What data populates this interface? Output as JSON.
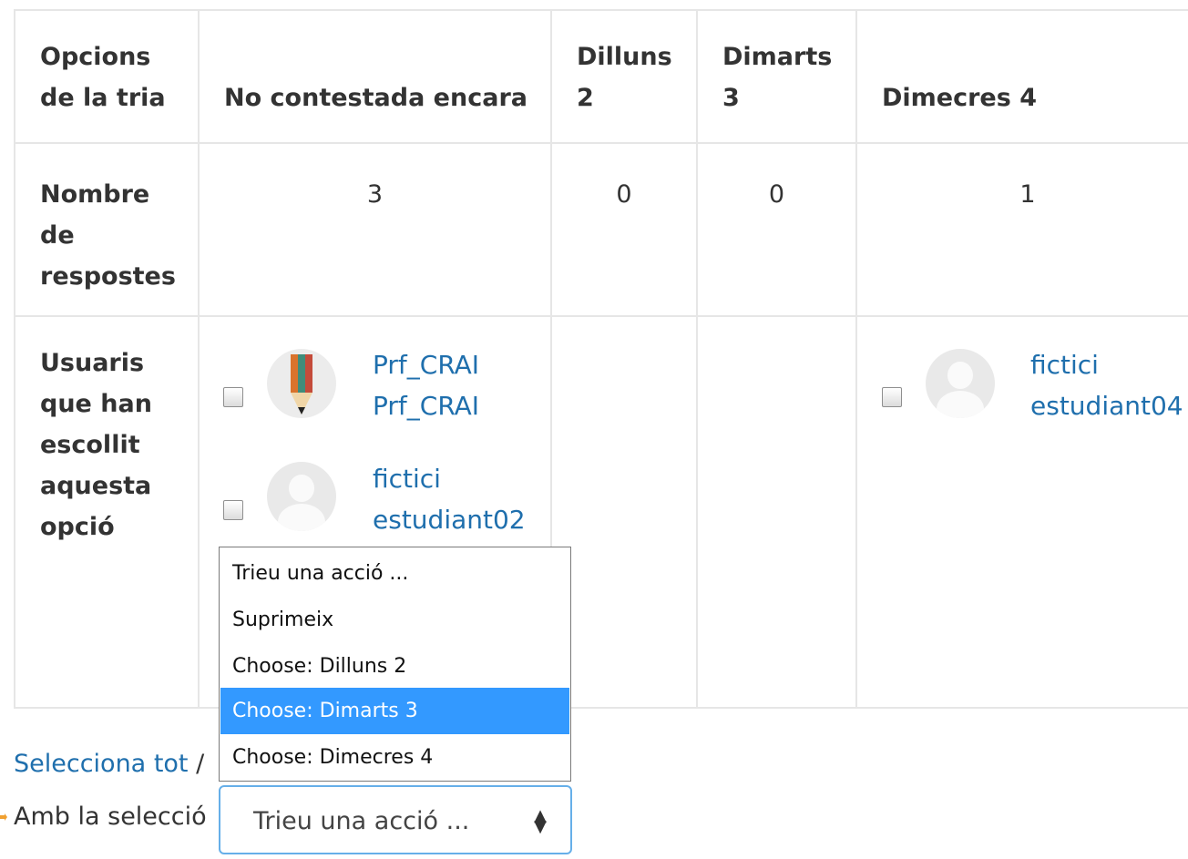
{
  "table": {
    "header": {
      "label": "Opcions de la tria",
      "columns": [
        "No contestada encara",
        "Dilluns 2",
        "Dimarts 3",
        "Dimecres 4"
      ]
    },
    "counts": {
      "label": "Nombre de respostes",
      "values": [
        "3",
        "0",
        "0",
        "1"
      ]
    },
    "users_row": {
      "label": "Usuaris que han escollit aquesta opció",
      "not_answered": [
        {
          "first": "Prf_CRAI",
          "last": "Prf_CRAI",
          "avatar": "pencil-avatar"
        },
        {
          "first": "fictici",
          "last": "estudiant02",
          "avatar": "default-avatar"
        }
      ],
      "dimecres": [
        {
          "first": "fictici",
          "last": "estudiant04",
          "avatar": "default-avatar"
        }
      ]
    }
  },
  "select_all": "Selecciona tot",
  "separator": "/",
  "with_selection_label": "Amb la selecció",
  "action_select": {
    "value": "Trieu una acció ...",
    "options": [
      "Trieu una acció ...",
      "Suprimeix",
      "Choose: Dilluns 2",
      "Choose: Dimarts 3",
      "Choose: Dimecres 4"
    ],
    "highlighted": "Choose: Dimarts 3"
  },
  "colors": {
    "link": "#1f6fad",
    "highlight": "#3399ff",
    "focus_border": "#66afe9",
    "arrow": "#f0a030"
  }
}
